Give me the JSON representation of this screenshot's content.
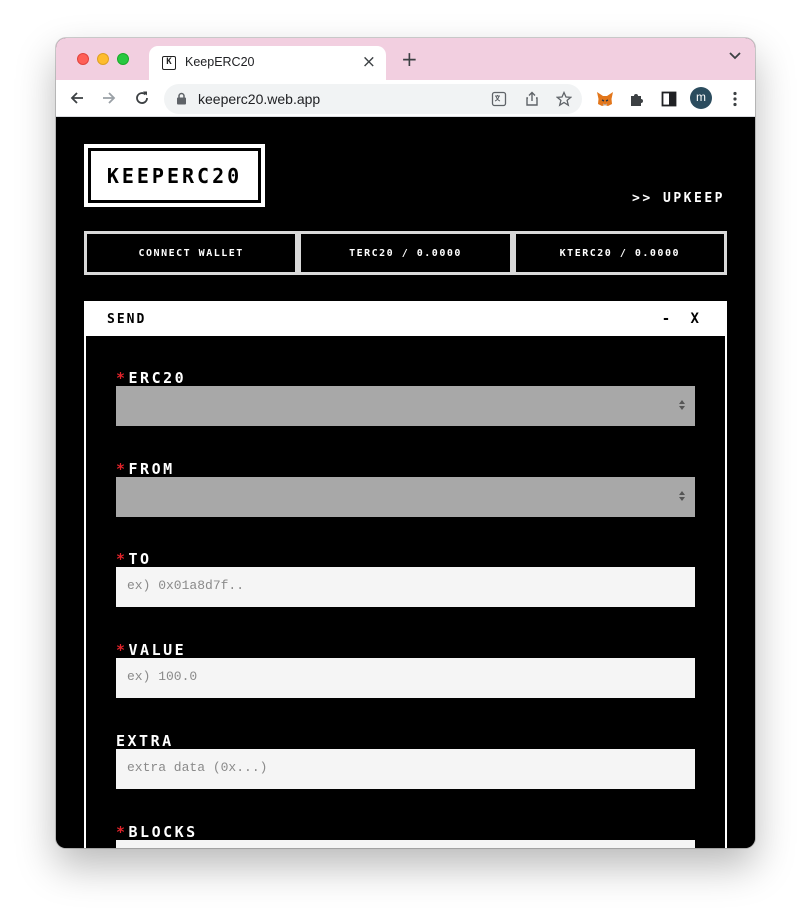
{
  "browser": {
    "tab_title": "KeepERC20",
    "tab_favicon": "K",
    "url": "keeperc20.web.app",
    "profile_initial": "m",
    "tabbar_color": "#f2cfe0"
  },
  "header": {
    "logo": "KEEPERC20",
    "upkeep_link": ">> UPKEEP",
    "buttons": [
      "CONNECT WALLET",
      "TERC20 / 0.0000",
      "KTERC20 / 0.0000"
    ]
  },
  "panel": {
    "title": "SEND",
    "controls": "- X",
    "required_mark": "*",
    "fields": {
      "erc20": {
        "label": "ERC20",
        "required": true,
        "type": "select",
        "value": ""
      },
      "from": {
        "label": "FROM",
        "required": true,
        "type": "select",
        "value": ""
      },
      "to": {
        "label": "TO",
        "required": true,
        "type": "input",
        "placeholder": "ex) 0x01a8d7f.."
      },
      "value": {
        "label": "VALUE",
        "required": true,
        "type": "input",
        "placeholder": "ex) 100.0"
      },
      "extra": {
        "label": "EXTRA",
        "required": false,
        "type": "input",
        "placeholder": "extra data (0x...)"
      },
      "blocks": {
        "label": "BLOCKS",
        "required": true,
        "type": "input",
        "placeholder": ""
      }
    }
  },
  "colors": {
    "background": "#000000",
    "required": "#e0232a",
    "select_bg": "#a8a8a8",
    "input_bg": "#f5f5f5"
  }
}
